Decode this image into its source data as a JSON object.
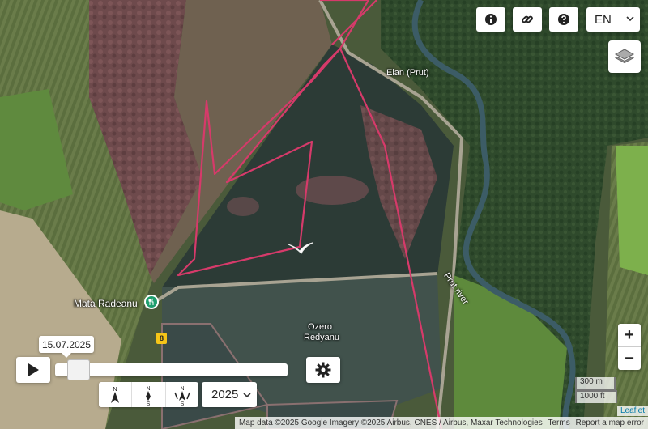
{
  "toolbar": {
    "info_icon": "info-icon",
    "link_icon": "link-icon",
    "help_icon": "question-icon",
    "language": "EN",
    "layers_icon": "layers-icon"
  },
  "map": {
    "labels": {
      "village_top": "Elan (Prut)",
      "village_left": "Mata Radeanu",
      "lake_line1": "Ozero",
      "lake_line2": "Redyanu",
      "river": "Prut river",
      "road_number": "8"
    },
    "track_color": "#d63a6a"
  },
  "player": {
    "date": "15.07.2025",
    "year": "2025",
    "progress": 0.05,
    "compass": [
      {
        "top": "N",
        "bottom": ""
      },
      {
        "top": "N",
        "bottom": "S"
      },
      {
        "top": "N",
        "bottom": "S"
      }
    ]
  },
  "zoom": {
    "in": "+",
    "out": "−"
  },
  "scale": {
    "metric": "300 m",
    "imperial": "1000 ft"
  },
  "attribution": {
    "leaflet": "Leaflet",
    "map_data": "Map data ©2025 Google Imagery ©2025 Airbus, CNES / Airbus, Maxar Technologies",
    "terms": "Terms",
    "report": "Report a map error"
  }
}
